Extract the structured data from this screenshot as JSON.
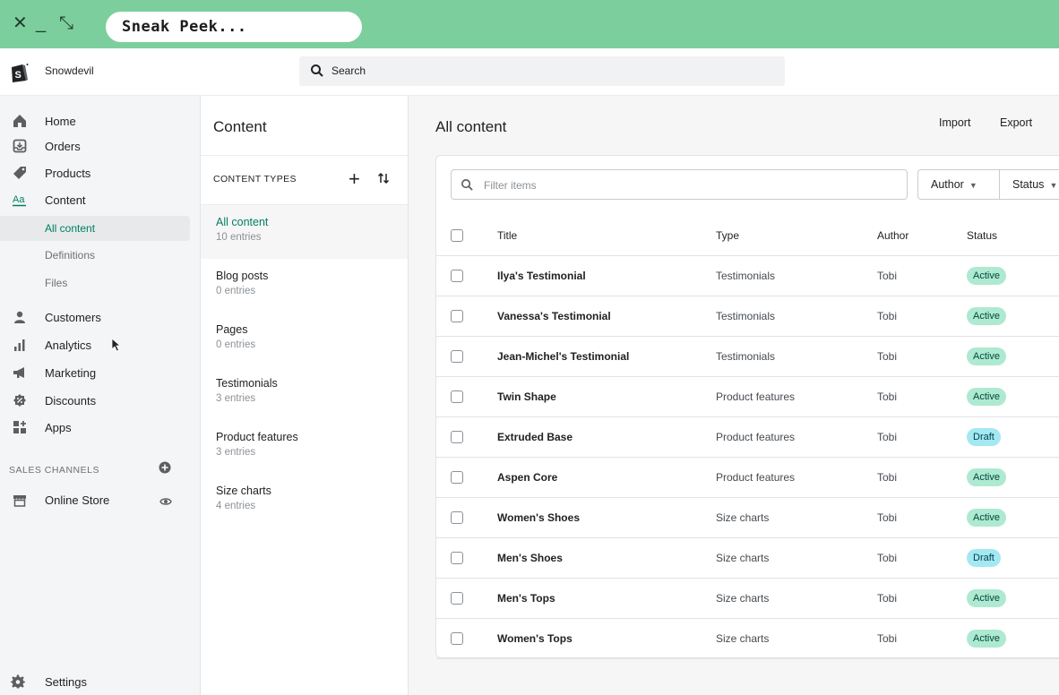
{
  "window": {
    "title": "Sneak Peek...",
    "controls": [
      "close-icon",
      "minimize-icon",
      "restore-icon"
    ]
  },
  "topbar": {
    "store_name": "Snowdevil",
    "search_placeholder": "Search"
  },
  "sidebar": {
    "items": [
      {
        "label": "Home",
        "icon": "home-icon"
      },
      {
        "label": "Orders",
        "icon": "orders-icon"
      },
      {
        "label": "Products",
        "icon": "tag-icon"
      },
      {
        "label": "Content",
        "icon": "content-icon"
      }
    ],
    "sub_items": [
      {
        "label": "All content",
        "active": true
      },
      {
        "label": "Definitions",
        "active": false
      },
      {
        "label": "Files",
        "active": false
      }
    ],
    "items2": [
      {
        "label": "Customers",
        "icon": "customers-icon"
      },
      {
        "label": "Analytics",
        "icon": "analytics-icon"
      },
      {
        "label": "Marketing",
        "icon": "megaphone-icon"
      },
      {
        "label": "Discounts",
        "icon": "discount-icon"
      },
      {
        "label": "Apps",
        "icon": "apps-icon"
      }
    ],
    "sales_channels_heading": "SALES CHANNELS",
    "online_store": "Online Store",
    "settings": "Settings"
  },
  "content_types": {
    "title": "Content",
    "header_label": "CONTENT TYPES",
    "add_symbol": "+",
    "items": [
      {
        "name": "All content",
        "count": "10 entries",
        "active": true
      },
      {
        "name": "Blog posts",
        "count": "0 entries",
        "active": false
      },
      {
        "name": "Pages",
        "count": "0 entries",
        "active": false
      },
      {
        "name": "Testimonials",
        "count": "3 entries",
        "active": false
      },
      {
        "name": "Product features",
        "count": "3 entries",
        "active": false
      },
      {
        "name": "Size charts",
        "count": "4 entries",
        "active": false
      }
    ]
  },
  "main": {
    "title": "All content",
    "import_label": "Import",
    "export_label": "Export",
    "filter_placeholder": "Filter items",
    "author_filter": "Author",
    "status_filter": "Status",
    "columns": {
      "title": "Title",
      "type": "Type",
      "author": "Author",
      "status": "Status"
    },
    "rows": [
      {
        "title": "Ilya's Testimonial",
        "type": "Testimonials",
        "author": "Tobi",
        "status": "Active"
      },
      {
        "title": "Vanessa's Testimonial",
        "type": "Testimonials",
        "author": "Tobi",
        "status": "Active"
      },
      {
        "title": "Jean-Michel's Testimonial",
        "type": "Testimonials",
        "author": "Tobi",
        "status": "Active"
      },
      {
        "title": "Twin Shape",
        "type": "Product features",
        "author": "Tobi",
        "status": "Active"
      },
      {
        "title": "Extruded Base",
        "type": "Product features",
        "author": "Tobi",
        "status": "Draft"
      },
      {
        "title": "Aspen Core",
        "type": "Product features",
        "author": "Tobi",
        "status": "Active"
      },
      {
        "title": "Women's Shoes",
        "type": "Size charts",
        "author": "Tobi",
        "status": "Active"
      },
      {
        "title": "Men's Shoes",
        "type": "Size charts",
        "author": "Tobi",
        "status": "Draft"
      },
      {
        "title": "Men's Tops",
        "type": "Size charts",
        "author": "Tobi",
        "status": "Active"
      },
      {
        "title": "Women's Tops",
        "type": "Size charts",
        "author": "Tobi",
        "status": "Active"
      }
    ]
  },
  "colors": {
    "window_bar": "#7ccf9d",
    "accent": "#008060",
    "badge_active": "#aee9d1",
    "badge_draft": "#a4e8f2"
  }
}
